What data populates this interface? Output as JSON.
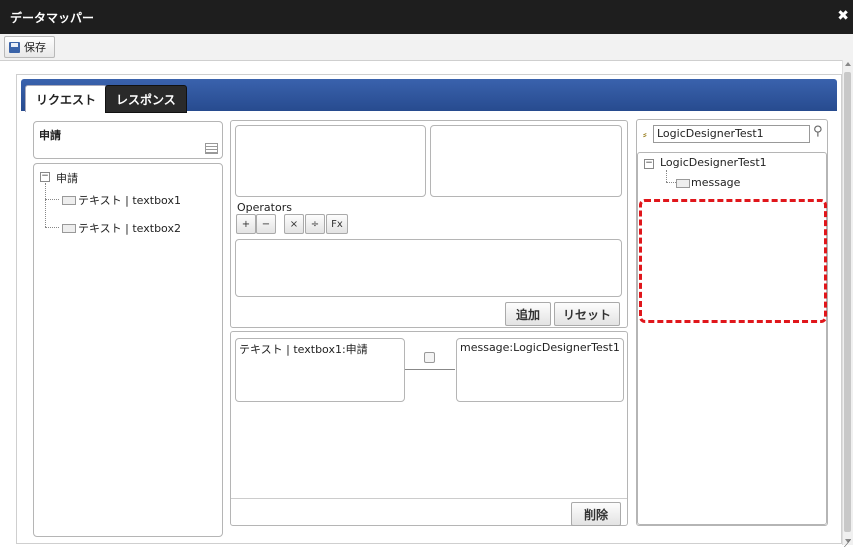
{
  "window": {
    "title": "データマッパー",
    "close_icon": "close-icon"
  },
  "toolbar": {
    "save_label": "保存",
    "save_icon": "floppy-icon"
  },
  "tabs": [
    {
      "label": "リクエスト",
      "active": true
    },
    {
      "label": "レスポンス",
      "active": false
    }
  ],
  "left_panel": {
    "header_label": "申請",
    "tree_root": "申請",
    "tree_items": [
      "テキスト | textbox1",
      "テキスト | textbox2"
    ]
  },
  "expression": {
    "operators_label": "Operators",
    "operators": [
      "+",
      "−",
      "×",
      "÷",
      "Fx"
    ],
    "add_label": "追加",
    "reset_label": "リセット"
  },
  "mapping": {
    "source": "テキスト | textbox1:申請",
    "target": "message:LogicDesignerTest1",
    "delete_label": "削除"
  },
  "right_panel": {
    "search_value": "LogicDesignerTest1",
    "tree_root": "LogicDesignerTest1",
    "tree_items": [
      "message"
    ]
  },
  "colors": {
    "tab_bar": "#2f56a0",
    "highlight_dashed": "#e0161b",
    "title_bar": "#1e1e1e"
  }
}
